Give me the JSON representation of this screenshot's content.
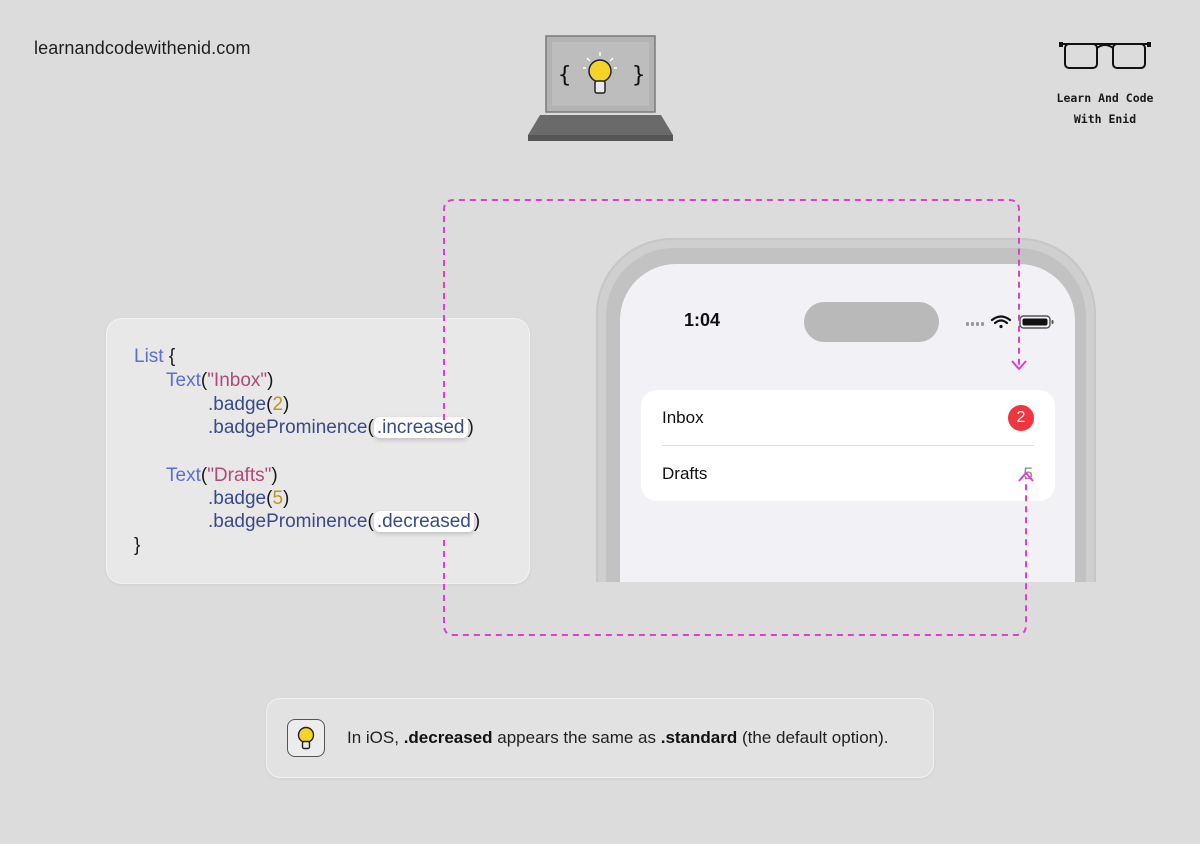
{
  "header": {
    "site_url": "learnandcodewithenid.com",
    "brand_line1": "Learn And Code",
    "brand_line2": "With Enid",
    "laptop_icon": "laptop-lightbulb-code-icon",
    "glasses_icon": "glasses-icon"
  },
  "code": {
    "line1_kw": "List",
    "line1_brace": " {",
    "line2_fn": "Text",
    "line2_open": "(",
    "line2_str": "\"Inbox\"",
    "line2_close": ")",
    "line3_mod": ".badge",
    "line3_open": "(",
    "line3_num": "2",
    "line3_close": ")",
    "line4_mod": ".badgeProminence",
    "line4_open": "(",
    "line4_hl": ".increased",
    "line4_close": ")",
    "line5_fn": "Text",
    "line5_open": "(",
    "line5_str": "\"Drafts\"",
    "line5_close": ")",
    "line6_mod": ".badge",
    "line6_open": "(",
    "line6_num": "5",
    "line6_close": ")",
    "line7_mod": ".badgeProminence",
    "line7_open": "(",
    "line7_hl": ".decreased",
    "line7_close": ")",
    "line8_brace": "}"
  },
  "phone": {
    "time": "1:04",
    "rows": [
      {
        "label": "Inbox",
        "badge": "2",
        "badge_style": "increased"
      },
      {
        "label": "Drafts",
        "badge": "5",
        "badge_style": "decreased"
      }
    ]
  },
  "note": {
    "icon": "lightbulb-icon",
    "prefix": "In iOS, ",
    "bold1": ".decreased",
    "middle": " appears the same as ",
    "bold2": ".standard",
    "suffix": " (the default option)."
  },
  "colors": {
    "background": "#dcdcdc",
    "connector": "#e040c8",
    "badge_red": "#f0353f",
    "keyword": "#5b6fcf",
    "modifier": "#3a4a86",
    "string": "#b04a7a",
    "number": "#b89a1a"
  }
}
